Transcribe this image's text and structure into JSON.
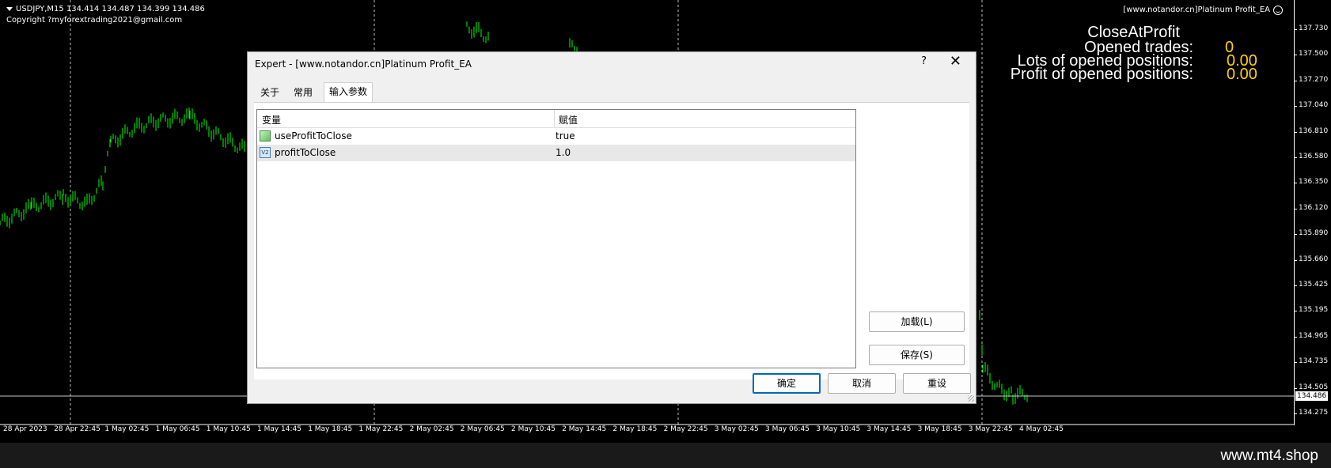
{
  "chart": {
    "symbol_line": "USDJPY,M15  134.414 134.487 134.399 134.486",
    "copyright": "Copyright ?myforextrading2021@gmail.com",
    "ea_label": "[www.notandor.cn]Platinum Profit_EA",
    "overlay": {
      "title": "CloseAtProfit",
      "opened_trades_label": "Opened trades:",
      "opened_trades_value": "0",
      "lots_label": "Lots of opened positions:",
      "lots_value": "0.00",
      "profit_label": "Profit of opened positions:",
      "profit_value": "0.00"
    },
    "price_axis": [
      "137.730",
      "137.500",
      "137.270",
      "137.040",
      "136.810",
      "136.580",
      "136.350",
      "136.120",
      "135.890",
      "135.660",
      "135.425",
      "135.195",
      "134.965",
      "134.735",
      "134.505",
      "134.275"
    ],
    "current_price": "134.486",
    "time_axis": [
      "28 Apr 2023",
      "28 Apr 22:45",
      "1 May 02:45",
      "1 May 06:45",
      "1 May 10:45",
      "1 May 14:45",
      "1 May 18:45",
      "1 May 22:45",
      "2 May 02:45",
      "2 May 06:45",
      "2 May 10:45",
      "2 May 14:45",
      "2 May 18:45",
      "2 May 22:45",
      "3 May 02:45",
      "3 May 06:45",
      "3 May 10:45",
      "3 May 14:45",
      "3 May 18:45",
      "3 May 22:45",
      "4 May 02:45"
    ],
    "colors": {
      "candle": "#00ff00",
      "background": "#000000",
      "overlay_value": "#ffd000"
    }
  },
  "dialog": {
    "title": "Expert - [www.notandor.cn]Platinum Profit_EA",
    "help_symbol": "?",
    "close_symbol": "✕",
    "tabs": [
      {
        "label": "关于"
      },
      {
        "label": "常用"
      },
      {
        "label": "输入参数",
        "active": true
      }
    ],
    "table": {
      "columns": [
        "变量",
        "赋值"
      ],
      "rows": [
        {
          "name": "useProfitToClose",
          "value": "true",
          "icon": "bool-param-icon"
        },
        {
          "name": "profitToClose",
          "value": "1.0",
          "icon": "double-param-icon",
          "icon_text": "V2",
          "selected": true
        }
      ]
    },
    "buttons": {
      "load": "加载(L)",
      "save": "保存(S)",
      "ok": "确定",
      "cancel": "取消",
      "reset": "重设"
    }
  },
  "footer": {
    "url": "www.mt4.shop"
  }
}
